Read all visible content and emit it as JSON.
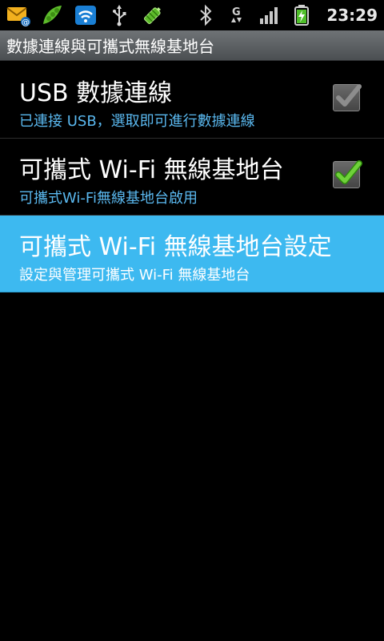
{
  "status_bar": {
    "time": "23:29",
    "icons_left": [
      "email-icon",
      "android-peas-icon",
      "wifi-hotspot-icon",
      "usb-icon",
      "battery-charge-notification-icon"
    ],
    "icons_right": [
      "bluetooth-icon",
      "g-network-icon",
      "signal-icon",
      "battery-icon"
    ]
  },
  "title_bar": {
    "title": "數據連線與可攜式無線基地台"
  },
  "items": [
    {
      "title": "USB 數據連線",
      "summary": "已連接 USB，選取即可進行數據連線",
      "checked": false
    },
    {
      "title": "可攜式 Wi-Fi 無線基地台",
      "summary": "可攜式Wi-Fi無線基地台啟用",
      "checked": true
    },
    {
      "title": "可攜式 Wi-Fi 無線基地台設定",
      "summary": "設定與管理可攜式 Wi-Fi 無線基地台",
      "selected": true
    }
  ],
  "colors": {
    "highlight": "#3db9f0",
    "summary_text": "#5ab8ef",
    "check_green": "#6fd13a",
    "title_bar": "#5c6063"
  }
}
